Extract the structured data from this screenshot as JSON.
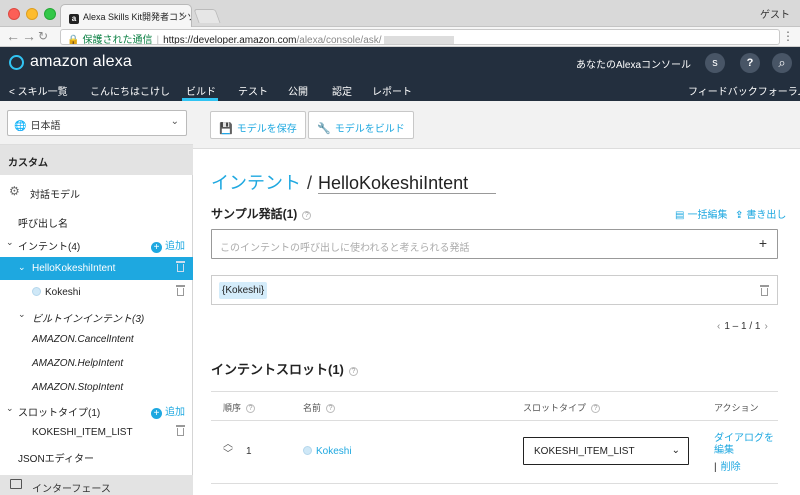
{
  "browser": {
    "tab_title": "Alexa Skills Kit開発者コンソール",
    "tab_favicon": "a",
    "profile": "ゲスト",
    "secure_label": "保護された通信",
    "url_host": "https://developer.amazon.com",
    "url_path": "/alexa/console/ask/"
  },
  "header": {
    "logo_text": "amazon alexa",
    "console_link": "あなたのAlexaコンソール",
    "avatar_letter": "s",
    "help_glyph": "?",
    "search_glyph": "⌕"
  },
  "navbar": {
    "back": "< スキル一覧",
    "skill_name": "こんにちはこけし",
    "tabs": [
      "ビルド",
      "テスト",
      "公開",
      "認定",
      "レポート"
    ],
    "active_tab": "ビルド",
    "feedback": "フィードバックフォーラム"
  },
  "sidebar": {
    "language": "日本語",
    "custom": "カスタム",
    "interaction_model": "対話モデル",
    "invocation": "呼び出し名",
    "intents_label": "インテント(4)",
    "add_label": "追加",
    "selected_intent": "HelloKokeshiIntent",
    "slot_under_intent": "Kokeshi",
    "builtin_label": "ビルトインインテント(3)",
    "builtin_items": [
      "AMAZON.CancelIntent",
      "AMAZON.HelpIntent",
      "AMAZON.StopIntent"
    ],
    "slot_types_label": "スロットタイプ(1)",
    "slot_type_item": "KOKESHI_ITEM_LIST",
    "json_editor": "JSONエディター",
    "interfaces": "インターフェース"
  },
  "toolbar": {
    "save_model": "モデルを保存",
    "build_model": "モデルをビルド"
  },
  "intent": {
    "breadcrumb": "インテント",
    "slash": "/",
    "name": "HelloKokeshiIntent"
  },
  "utterances": {
    "title": "サンプル発話(1)",
    "bulk_edit": "一括編集",
    "export": "書き出し",
    "placeholder": "このインテントの呼び出しに使われると考えられる発話",
    "add_glyph": "+",
    "items": [
      "{Kokeshi}"
    ],
    "pager": "1 – 1 / 1"
  },
  "slots": {
    "title": "インテントスロット(1)",
    "headers": {
      "order": "順序",
      "name": "名前",
      "type": "スロットタイプ",
      "action": "アクション"
    },
    "row": {
      "order": "1",
      "name": "Kokeshi",
      "type": "KOKESHI_ITEM_LIST",
      "edit_dialog": "ダイアログを編集",
      "delete": "削除"
    }
  },
  "colors": {
    "accent": "#1ea8e0",
    "header_bg": "#232f3e",
    "selected_bg": "#1ea8e0"
  }
}
